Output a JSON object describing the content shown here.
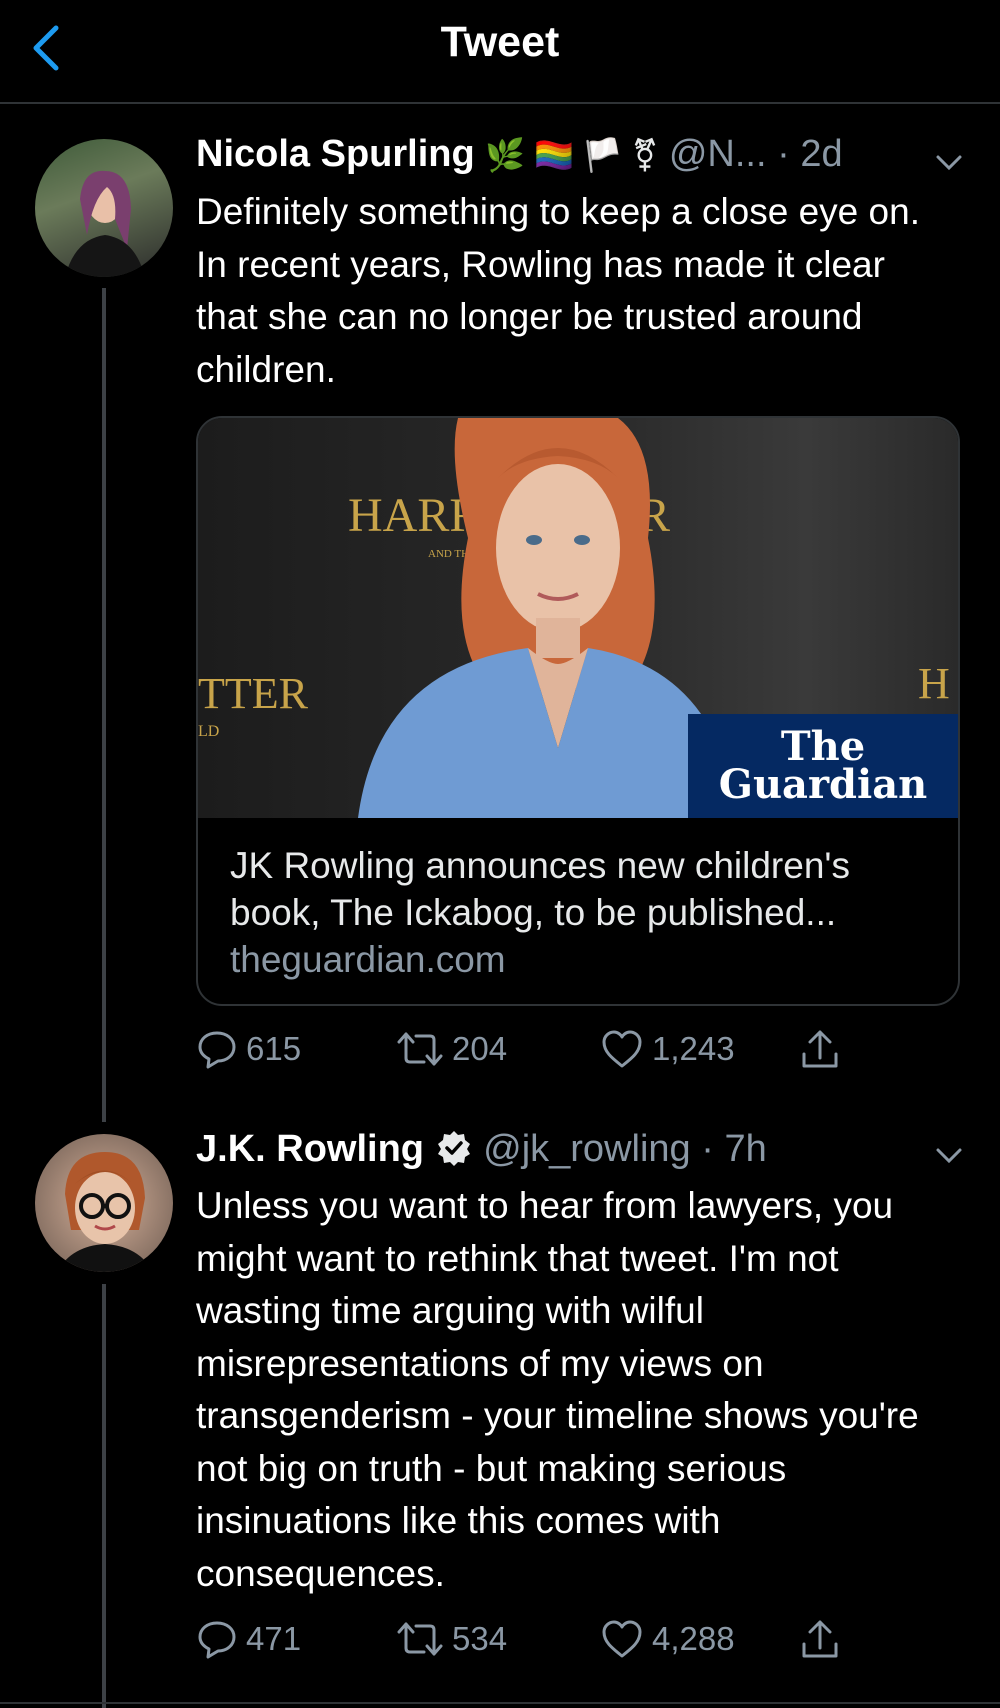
{
  "header": {
    "title": "Tweet"
  },
  "tweets": [
    {
      "name": "Nicola Spurling",
      "emojis": "🌿 🏳️‍🌈 🏳️ ⚧",
      "handle": "@N...",
      "sep": " · ",
      "time": "2d",
      "text": "Definitely something to keep a close eye on. In recent years, Rowling has made it clear that she can no longer be trusted around children.",
      "card": {
        "title": "JK Rowling announces new children's book, The Ickabog, to be published...",
        "domain": "theguardian.com",
        "logo_line1": "The",
        "logo_line2": "Guardian",
        "sign_text_1": "HARRY",
        "sign_text_1b": "R",
        "sign_text_2": "AND THE",
        "sign_text_3": "TTER",
        "sign_text_4": "LD",
        "sign_text_5": "H"
      },
      "replies": "615",
      "retweets": "204",
      "likes": "1,243"
    },
    {
      "name": "J.K. Rowling",
      "handle": "@jk_rowling",
      "sep": " · ",
      "time": "7h",
      "text": "Unless you want to hear from lawyers, you might want to rethink that tweet. I'm not wasting time arguing with wilful misrepresentations of my views on transgenderism - your timeline shows you're not big on truth - but making serious insinuations like this comes with consequences.",
      "replies": "471",
      "retweets": "534",
      "likes": "4,288"
    }
  ],
  "colors": {
    "accent": "#1d9bf0",
    "muted": "#8b98a5",
    "background": "#000000"
  }
}
